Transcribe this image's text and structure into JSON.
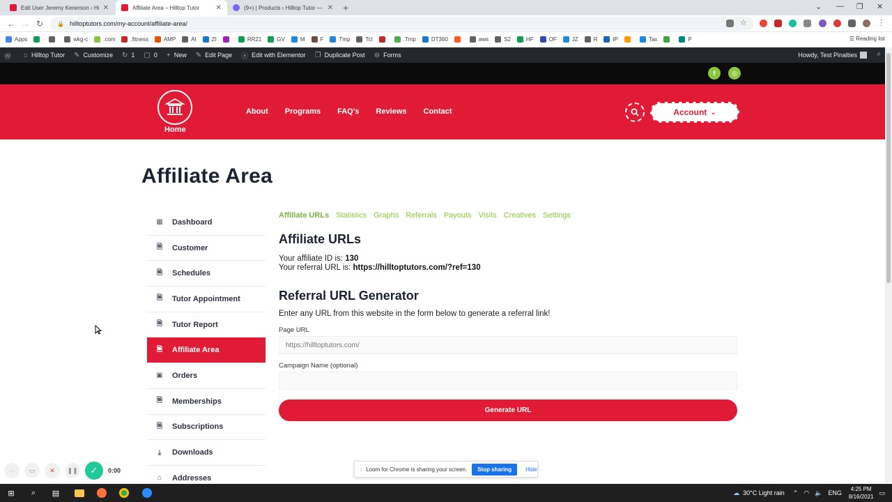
{
  "browser": {
    "tabs": [
      {
        "title": "Edit User Jeremy Kenerson ‹ Hillt",
        "favicon_color": "#e11b36",
        "active": false
      },
      {
        "title": "Affiliate Area – Hilltop Tutor",
        "favicon_color": "#e11b36",
        "active": true
      },
      {
        "title": "(9+) | Products ‹ Hilltop Tutor —",
        "favicon_color": "#7b61ff",
        "active": false
      }
    ],
    "new_tab": "+",
    "url": "hilltoptutors.com/my-account/affiliate-area/",
    "bookmarks": [
      "Apps",
      "",
      "",
      "wkg-c",
      ".com",
      ".fitness",
      "AMP",
      "AI",
      "ZI",
      "",
      "RR21",
      "GV",
      "M",
      "F",
      "Tmp",
      "Tct",
      "",
      ".Tmp",
      "DT360",
      "",
      "aws",
      "S2",
      "HF",
      "OF",
      "JZ",
      "R",
      "IP",
      "",
      "Tax",
      "",
      "P"
    ],
    "reading_list": "Reading list"
  },
  "wp_admin_bar": {
    "items": [
      {
        "icon": "wordpress-icon",
        "label": ""
      },
      {
        "icon": "home-icon",
        "label": "Hilltop Tutor"
      },
      {
        "icon": "brush-icon",
        "label": "Customize"
      },
      {
        "icon": "update-icon",
        "label": "1"
      },
      {
        "icon": "comment-icon",
        "label": "0"
      },
      {
        "icon": "plus-icon",
        "label": "New"
      },
      {
        "icon": "edit-icon",
        "label": "Edit Page"
      },
      {
        "icon": "elementor-icon",
        "label": "Edit with Elementor"
      },
      {
        "icon": "duplicate-icon",
        "label": "Duplicate Post"
      },
      {
        "icon": "forms-icon",
        "label": "Forms"
      }
    ],
    "howdy": "Howdy, Test Pinalties"
  },
  "site": {
    "social": [
      {
        "icon": "facebook-icon",
        "glyph": "f"
      },
      {
        "icon": "instagram-icon",
        "glyph": "◎"
      }
    ],
    "logo_label": "Home",
    "nav": [
      "About",
      "Programs",
      "FAQ's",
      "Reviews",
      "Contact"
    ],
    "account_label": "Account",
    "account_caret": "⌄",
    "brand_red": "#e11b36",
    "accent_green": "#8cc63f"
  },
  "page": {
    "title": "Affiliate Area",
    "sidebar": [
      {
        "label": "Dashboard",
        "icon": "dashboard-icon",
        "active": false
      },
      {
        "label": "Customer",
        "icon": "document-icon",
        "active": false
      },
      {
        "label": "Schedules",
        "icon": "document-icon",
        "active": false
      },
      {
        "label": "Tutor Appointment",
        "icon": "document-icon",
        "active": false
      },
      {
        "label": "Tutor Report",
        "icon": "document-icon",
        "active": false
      },
      {
        "label": "Affiliate Area",
        "icon": "document-icon",
        "active": true
      },
      {
        "label": "Orders",
        "icon": "cart-icon",
        "active": false
      },
      {
        "label": "Memberships",
        "icon": "document-icon",
        "active": false
      },
      {
        "label": "Subscriptions",
        "icon": "document-icon",
        "active": false
      },
      {
        "label": "Downloads",
        "icon": "download-icon",
        "active": false
      },
      {
        "label": "Addresses",
        "icon": "home-icon",
        "active": false
      }
    ],
    "subtabs": [
      {
        "label": "Affiliate URLs",
        "active": true
      },
      {
        "label": "Statistics",
        "active": false
      },
      {
        "label": "Graphs",
        "active": false
      },
      {
        "label": "Referrals",
        "active": false
      },
      {
        "label": "Payouts",
        "active": false
      },
      {
        "label": "Visits",
        "active": false
      },
      {
        "label": "Creatives",
        "active": false
      },
      {
        "label": "Settings",
        "active": false
      }
    ],
    "affiliate_urls_heading": "Affiliate URLs",
    "affiliate_id_text": "Your affiliate ID is: ",
    "affiliate_id": "130",
    "referral_url_text": "Your referral URL is: ",
    "referral_url": "https://hilltoptutors.com/?ref=130",
    "generator_heading": "Referral URL Generator",
    "generator_intro": "Enter any URL from this website in the form below to generate a referral link!",
    "page_url_label": "Page URL",
    "page_url_value": "https://hilltoptutors.com/",
    "campaign_label": "Campaign Name (optional)",
    "campaign_value": "",
    "generate_button": "Generate URL"
  },
  "loom": {
    "timer": "0:00",
    "sharing_text": "Loom for Chrome is sharing your screen.",
    "stop_button": "Stop sharing",
    "hide_link": "Hide"
  },
  "taskbar": {
    "weather": "30°C  Light rain",
    "language": "ENG",
    "time": "4:25 PM",
    "date": "8/16/2021"
  }
}
